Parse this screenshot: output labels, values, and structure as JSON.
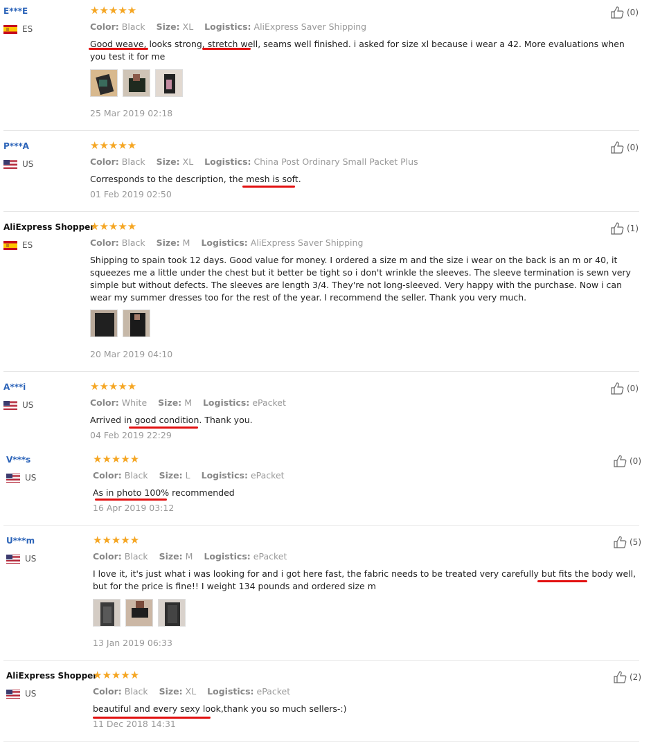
{
  "labels": {
    "color": "Color:",
    "size": "Size:",
    "logistics": "Logistics:"
  },
  "stars": "★★★★★",
  "reviews": [
    {
      "name": "E***E",
      "country": "ES",
      "color": "Black",
      "size": "XL",
      "logistics": "AliExpress Saver Shipping",
      "text": "Good weave, looks strong, stretch well, seams well finished. i asked for size xl because i wear a 42. More evaluations when you test it for me",
      "date": "25 Mar 2019 02:18",
      "helpful": "(0)"
    },
    {
      "name": "P***A",
      "country": "US",
      "color": "Black",
      "size": "XL",
      "logistics": "China Post Ordinary Small Packet Plus",
      "text": "Corresponds to the description, the mesh is soft.",
      "date": "01 Feb 2019 02:50",
      "helpful": "(0)"
    },
    {
      "name": "AliExpress Shopper",
      "country": "ES",
      "color": "Black",
      "size": "M",
      "logistics": "AliExpress Saver Shipping",
      "text": "Shipping to spain took 12 days. Good value for money. I ordered a size m and the size i wear on the back is an m or 40, it squeezes me a little under the chest but it better be tight so i don't wrinkle the sleeves. The sleeve termination is sewn very simple but without defects. The sleeves are length 3/4. They're not long-sleeved. Very happy with the purchase. Now i can wear my summer dresses too for the rest of the year. I recommend the seller. Thank you very much.",
      "date": "20 Mar 2019 04:10",
      "helpful": "(1)"
    },
    {
      "name": "A***i",
      "country": "US",
      "color": "White",
      "size": "M",
      "logistics": "ePacket",
      "text": "Arrived in good condition. Thank you.",
      "date": "04 Feb 2019 22:29",
      "helpful": "(0)"
    },
    {
      "name": "V***s",
      "country": "US",
      "color": "Black",
      "size": "L",
      "logistics": "ePacket",
      "text": "As in photo 100% recommended",
      "date": "16 Apr 2019 03:12",
      "helpful": "(0)"
    },
    {
      "name": "U***m",
      "country": "US",
      "color": "Black",
      "size": "M",
      "logistics": "ePacket",
      "text": "I love it, it's just what i was looking for and i got here fast, the fabric needs to be treated very carefully but fits the body well, but for the price is fine!! I weight 134 pounds and ordered size m",
      "date": "13 Jan 2019 06:33",
      "helpful": "(5)"
    },
    {
      "name": "AliExpress Shopper",
      "country": "US",
      "color": "Black",
      "size": "XL",
      "logistics": "ePacket",
      "text": "beautiful and every sexy look,thank you so much sellers-:)",
      "date": "11 Dec 2018 14:31",
      "helpful": "(2)"
    }
  ],
  "colors": {
    "star": "#f5a623",
    "name_link": "#2b63b8",
    "underline": "#e21010"
  }
}
